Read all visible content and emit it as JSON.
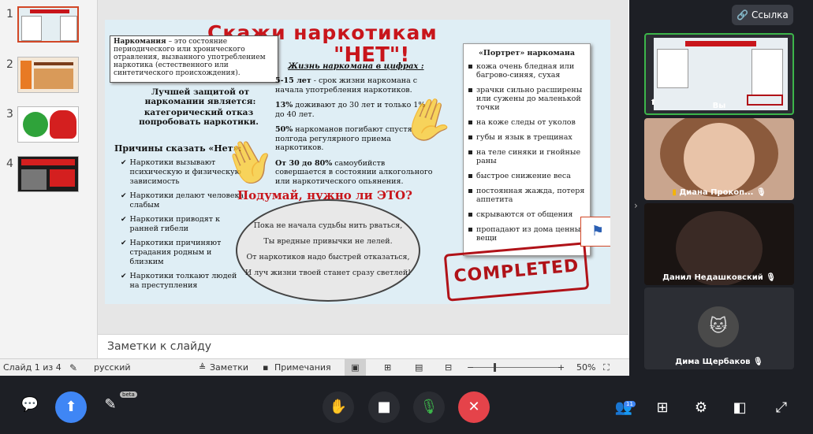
{
  "ppt": {
    "thumbnails": [
      {
        "number": "1"
      },
      {
        "number": "2"
      },
      {
        "number": "3"
      },
      {
        "number": "4"
      }
    ],
    "notes_placeholder": "Заметки к слайду",
    "status": {
      "slide_counter": "Слайд 1 из 4",
      "language": "русский",
      "notes": "Заметки",
      "comments": "Примечания",
      "zoom": "50%",
      "zoom_minus": "−",
      "zoom_plus": "+"
    }
  },
  "slide": {
    "title": "Скажи наркотикам",
    "net": "\"НЕТ\"!",
    "callout_term": "Наркомания",
    "callout_text": " – это состояние периодического или хронического отравления, вызванного употреблением наркотика (естественного или синтетического происхождения).",
    "best_protection_1": "Лучшей защитой от наркомании является:",
    "best_protection_2": "категорический отказ попробовать наркотики.",
    "reasons_title": "Причины сказать «Нет»:",
    "reasons": [
      "Наркотики вызывают психическую и физическую зависимость",
      "Наркотики делают человека слабым",
      "Наркотики приводят к ранней гибели",
      "Наркотики причиняют страдания родным и близким",
      "Наркотики толкают людей на преступления"
    ],
    "numbers_title": "Жизнь наркомана в цифрах :",
    "numbers": [
      {
        "bold": "5-15 лет",
        "text": " - срок жизни наркомана с начала употребления наркотиков."
      },
      {
        "bold": "13%",
        "text": " доживают до 30 лет и только 1% до 40 лет."
      },
      {
        "bold": "50%",
        "text": " наркоманов погибают спустя полгода регулярного приема наркотиков."
      },
      {
        "bold": "От 30 до 80%",
        "text": " самоубийств совершается в состоянии алкогольного или наркотического опьянения."
      }
    ],
    "ask": "Подумай, нужно ли ЭТО?",
    "poem": [
      "Пока не начала судьбы нить рваться,",
      "Ты вредные привычки не лелей.",
      "От наркотиков надо быстрей отказаться,",
      "И луч жизни твоей станет сразу светлей!"
    ],
    "portrait_title": "«Портрет» наркомана",
    "portrait": [
      "кожа очень бледная или багрово-синяя, сухая",
      "зрачки сильно расширены или сужены до маленькой точки",
      "на коже следы от уколов",
      "губы и язык в трещинах",
      "на теле синяки и гнойные раны",
      "быстрое снижение веса",
      "постоянная жажда, потеря аппетита",
      "скрываются от общения",
      "пропадают из дома ценные вещи"
    ],
    "stamp": "COMPLETED"
  },
  "conference": {
    "link_button": "Ссылка",
    "participants": [
      {
        "name": "Вы"
      },
      {
        "name": "Диана Прокоп..."
      },
      {
        "name": "Данил Недашковский"
      },
      {
        "name": "Дима Щербаков"
      }
    ],
    "participants_count": "11",
    "beta_label": "beta"
  }
}
